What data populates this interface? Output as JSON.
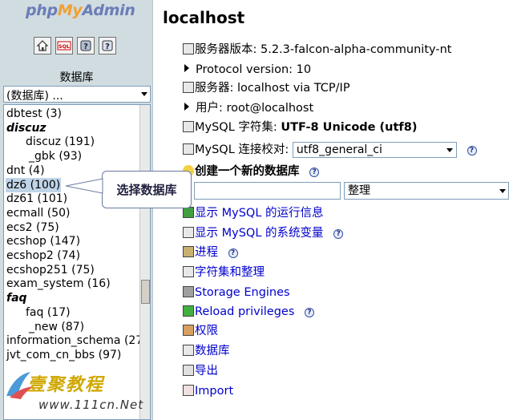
{
  "left": {
    "logo_php": "php",
    "logo_my": "My",
    "logo_admin": "Admin",
    "toolbar_icons": [
      "home-icon",
      "sql-icon",
      "query-window-icon",
      "docs-icon"
    ],
    "database_label": "数据库",
    "database_select": "(数据库) ...",
    "databases": [
      {
        "label": "dbtest (3)",
        "kind": "db"
      },
      {
        "label": "discuz",
        "kind": "group"
      },
      {
        "label": "discuz (191)",
        "kind": "sub"
      },
      {
        "label": "_gbk (93)",
        "kind": "sub2"
      },
      {
        "label": "dnt (4)",
        "kind": "db"
      },
      {
        "label": "dz6 (100)",
        "kind": "selected"
      },
      {
        "label": "dz61 (101)",
        "kind": "db"
      },
      {
        "label": "ecmall (50)",
        "kind": "db"
      },
      {
        "label": "ecs2 (75)",
        "kind": "db"
      },
      {
        "label": "ecshop (147)",
        "kind": "db"
      },
      {
        "label": "ecshop2 (74)",
        "kind": "db"
      },
      {
        "label": "ecshop251 (75)",
        "kind": "db"
      },
      {
        "label": "exam_system (16)",
        "kind": "db"
      },
      {
        "label": "faq",
        "kind": "group"
      },
      {
        "label": "faq (17)",
        "kind": "sub"
      },
      {
        "label": "_new (87)",
        "kind": "sub2"
      },
      {
        "label": "information_schema (27",
        "kind": "db"
      },
      {
        "label": "jvt_com_cn_bbs (97)",
        "kind": "db"
      }
    ],
    "callout": "选择数据库",
    "watermark_text": "壹聚教程",
    "watermark_url": "www.111cn.Net"
  },
  "right": {
    "title": "localhost",
    "server_version": "服务器版本: 5.2.3-falcon-alpha-community-nt",
    "protocol": "Protocol version: 10",
    "server": "服务器: localhost via TCP/IP",
    "user": "用户: root@localhost",
    "charset_label": "MySQL 字符集: ",
    "charset_value": "UTF-8 Unicode (utf8)",
    "collation_label": "MySQL 连接校对: ",
    "collation_value": "utf8_general_ci",
    "create_db": "创建一个新的数据库",
    "new_db_placeholder": "",
    "collation_option": "整理",
    "links": {
      "runtime": "显示  MySQL 的运行信息",
      "variables": "显示  MySQL 的系统变量",
      "processes": "进程",
      "charsets": "字符集和整理",
      "engines": "Storage Engines",
      "reload": "Reload privileges",
      "privileges": "权限",
      "databases": "数据库",
      "export": "导出",
      "import": "Import"
    },
    "help_glyph": "?"
  },
  "colors": {
    "left_bg": "#d0dce0",
    "link": "#0000cc",
    "selected_bg": "#c0d4e8",
    "logo_blue": "#6b7db8",
    "logo_orange": "#f0a030"
  }
}
